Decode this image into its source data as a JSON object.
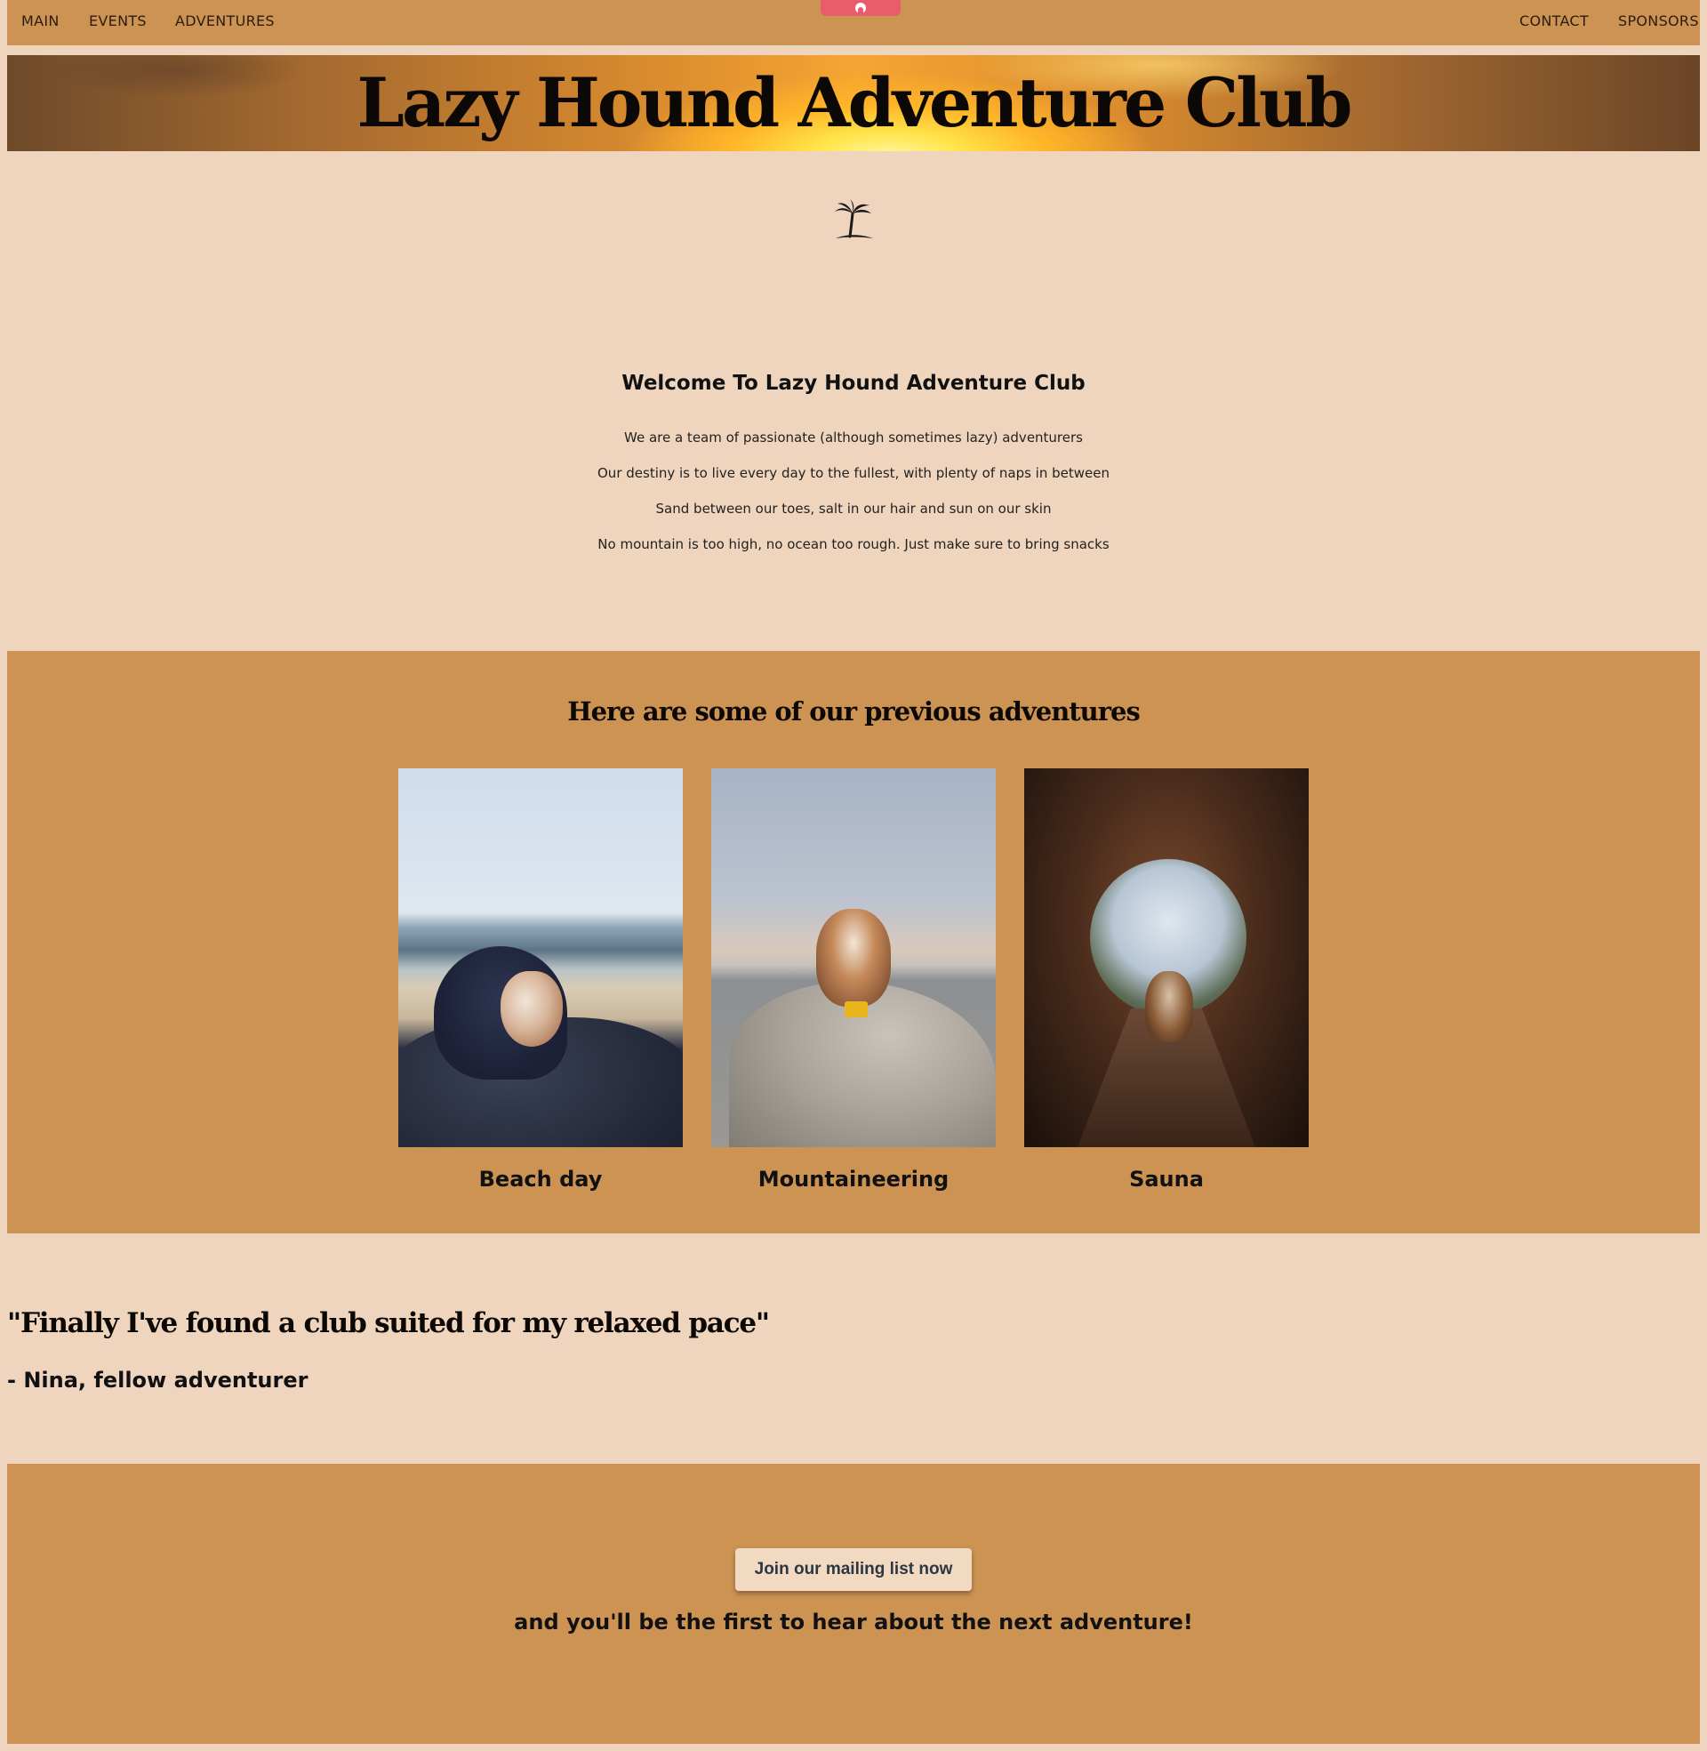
{
  "nav": {
    "left_items": [
      {
        "label": "MAIN"
      },
      {
        "label": "EVENTS"
      },
      {
        "label": "ADVENTURES"
      }
    ],
    "right_items": [
      {
        "label": "CONTACT"
      },
      {
        "label": "SPONSORS"
      }
    ],
    "tab_handle_icon": "eye-icon"
  },
  "hero": {
    "title": "Lazy Hound Adventure Club"
  },
  "logo_icon": "palm-tree-icon",
  "welcome": {
    "heading": "Welcome To Lazy Hound Adventure Club",
    "lines": [
      "We are a team of passionate (although sometimes lazy) adventurers",
      "Our destiny is to live every day to the fullest, with plenty of naps in between",
      "Sand between our toes, salt in our hair and sun on our skin",
      "No mountain is too high, no ocean too rough. Just make sure to bring snacks"
    ]
  },
  "adventures": {
    "heading": "Here are some of our previous adventures",
    "items": [
      {
        "label": "Beach day"
      },
      {
        "label": "Mountaineering"
      },
      {
        "label": "Sauna"
      }
    ]
  },
  "testimonial": {
    "quote": "\"Finally I've found a club suited for my relaxed pace\"",
    "author": "- Nina, fellow adventurer"
  },
  "cta": {
    "button_label": "Join our mailing list now",
    "text": "and you'll be the first to hear about the next adventure!"
  },
  "colors": {
    "page_background": "#efd5bd",
    "band_background": "#cd9353",
    "accent_tab": "#e85c6c",
    "button_background": "#f2d9c2"
  }
}
